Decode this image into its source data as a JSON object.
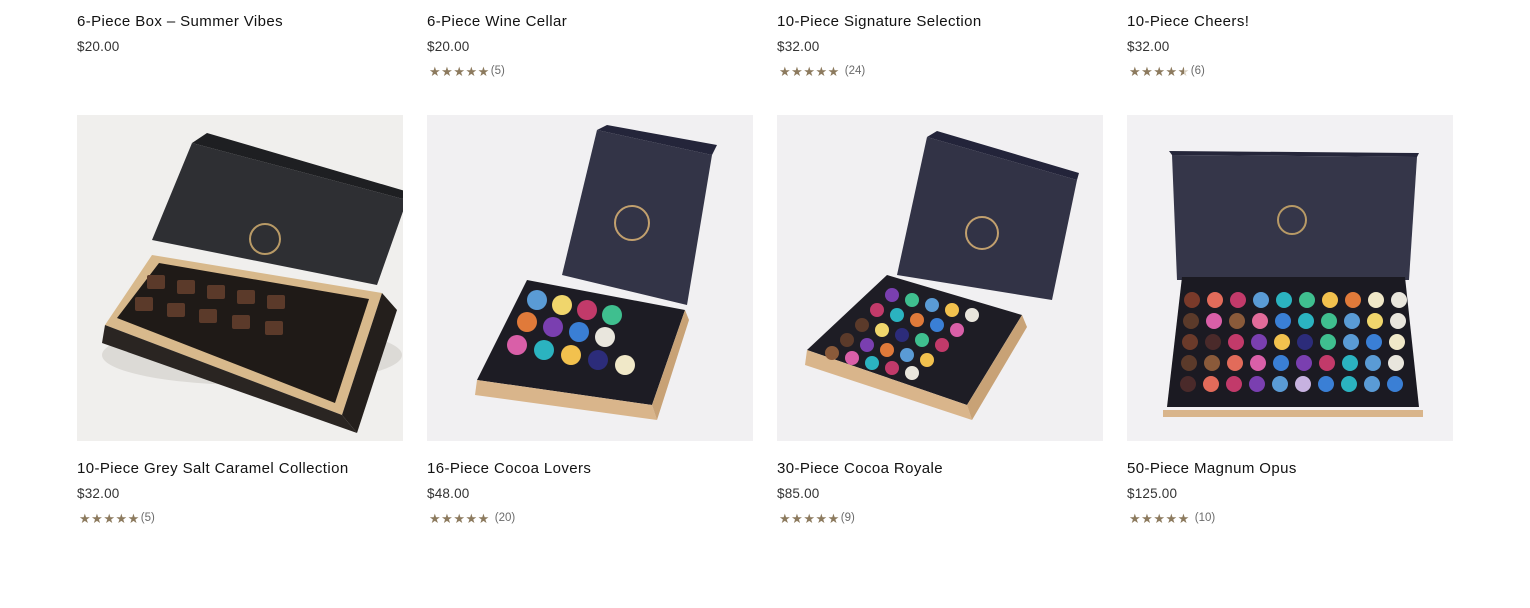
{
  "products_top": [
    {
      "title": "6-Piece Box – Summer Vibes",
      "price": "$20.00",
      "rating_count": "",
      "rating": null
    },
    {
      "title": "6-Piece Wine Cellar",
      "price": "$20.00",
      "rating_count": "(5)",
      "rating": 4.8
    },
    {
      "title": "10-Piece Signature Selection",
      "price": "$32.00",
      "rating_count": "(24)",
      "rating": 5
    },
    {
      "title": "10-Piece Cheers!",
      "price": "$32.00",
      "rating_count": "(6)",
      "rating": 4.5
    }
  ],
  "products_bottom": [
    {
      "title": "10-Piece Grey Salt Caramel Collection",
      "price": "$32.00",
      "rating_count": "(5)",
      "rating": 4.8,
      "image": "chocolate-box-10-caramel"
    },
    {
      "title": "16-Piece Cocoa Lovers",
      "price": "$48.00",
      "rating_count": "(20)",
      "rating": 5,
      "image": "chocolate-box-16"
    },
    {
      "title": "30-Piece Cocoa Royale",
      "price": "$85.00",
      "rating_count": "(9)",
      "rating": 4.8,
      "image": "chocolate-box-30"
    },
    {
      "title": "50-Piece Magnum Opus",
      "price": "$125.00",
      "rating_count": "(10)",
      "rating": 5,
      "image": "chocolate-box-50"
    }
  ],
  "colors": {
    "star": "#8c7a5e",
    "box_lid": "#2f3142",
    "box_base": "#d8b98c"
  },
  "icons": {
    "star": "star-icon"
  }
}
